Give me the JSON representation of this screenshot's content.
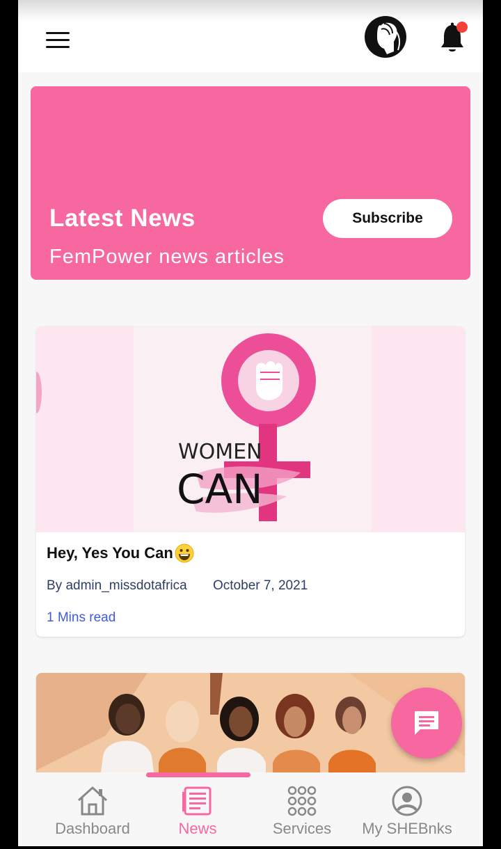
{
  "header": {
    "menu_icon": "hamburger-menu-icon",
    "logo_icon": "woman-profile-logo-icon",
    "notification_icon": "bell-icon",
    "notification_dot_color": "#f44336"
  },
  "banner": {
    "title": "Latest News",
    "subtitle": "FemPower news articles",
    "subscribe_label": "Subscribe",
    "background_color": "#f767a0"
  },
  "articles": [
    {
      "title": "Hey, Yes You Can",
      "title_emoji": "grinning-face-emoji",
      "image_text_line1": "WOMEN",
      "image_text_line2": "CAN",
      "author": "By admin_missdotafrica",
      "date": "October 7, 2021",
      "read_time": "1 Mins read"
    },
    {
      "image": "group-of-women-illustration"
    }
  ],
  "chat_fab": {
    "icon": "chat-message-icon"
  },
  "bottom_nav": {
    "active": "News",
    "items": [
      {
        "label": "Dashboard",
        "icon": "home-icon"
      },
      {
        "label": "News",
        "icon": "newspaper-icon"
      },
      {
        "label": "Services",
        "icon": "grid-dots-icon"
      },
      {
        "label": "My SHEBnks",
        "icon": "user-circle-icon"
      }
    ]
  }
}
